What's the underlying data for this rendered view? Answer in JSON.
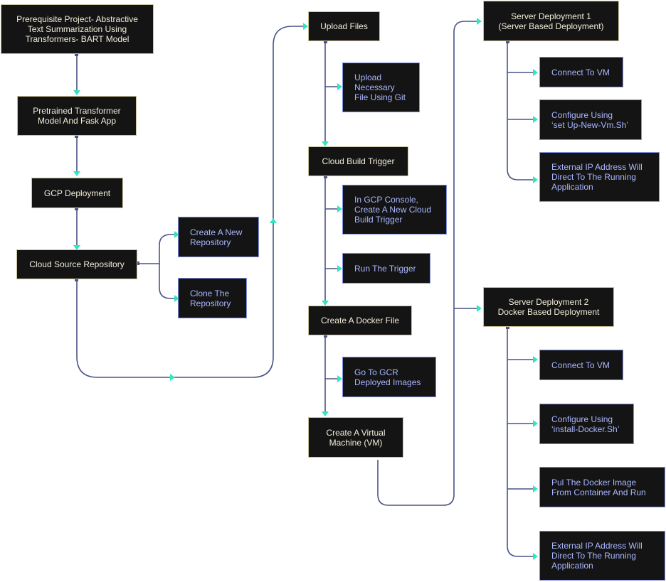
{
  "diagram": {
    "colors": {
      "node_bg": "#141414",
      "main_border": "#c9c19a",
      "main_text": "#f2ecd9",
      "sub_border": "#7f8fe0",
      "sub_text": "#a9b6ff",
      "edge": "#4a5487",
      "arrow": "#2ee6c0"
    },
    "nodes": {
      "prerequisite": "Prerequisite Project- Abstractive\nText Summarization Using\nTransformers- BART Model",
      "pretrained": "Pretrained Transformer\nModel And Fask App",
      "gcp_deployment": "GCP Deployment",
      "cloud_source_repo": "Cloud Source Repository",
      "create_new_repo": "Create A New\nRepository",
      "clone_repo": "Clone The\nRepository",
      "upload_files": "Upload Files",
      "upload_git": "Upload\nNecessary\nFile Using Git",
      "cloud_build_trigger": "Cloud Build Trigger",
      "gcp_console_trigger": "In GCP Console,\nCreate A New Cloud\nBuild Trigger",
      "run_trigger": "Run The Trigger",
      "docker_file": "Create A Docker File",
      "gcr_images": "Go To GCR\nDeployed Images",
      "create_vm": "Create A Virtual\nMachine (VM)",
      "server_dep1": "Server Deployment 1\n(Server Based Deployment)",
      "s1_connect_vm": "Connect To VM",
      "s1_configure": "Configure Using\n‘set Up-New-Vm.Sh’",
      "s1_external_ip": "External IP Address Will\nDirect To The Running\nApplication",
      "server_dep2": "Server Deployment 2\nDocker Based Deployment",
      "s2_connect_vm": "Connect To VM",
      "s2_configure": "Configure Using\n‘install-Docker.Sh’",
      "s2_pull_image": "Pul The Docker Image\nFrom Container And Run",
      "s2_external_ip": "External IP Address Will\nDirect To The Running\nApplication"
    }
  }
}
